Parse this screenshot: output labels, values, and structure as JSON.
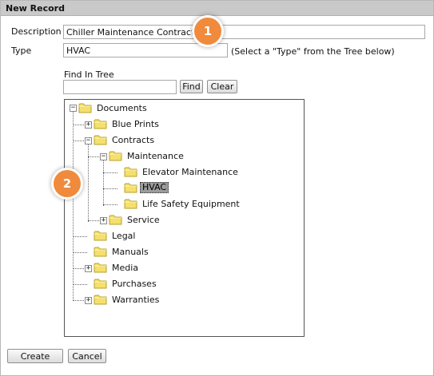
{
  "dialog": {
    "title": "New Record"
  },
  "form": {
    "description_label": "Description",
    "description_value": "Chiller Maintenance Contract",
    "type_label": "Type",
    "type_value": "HVAC",
    "type_hint": "(Select a \"Type\" from the Tree below)",
    "find_label": "Find In Tree",
    "find_value": "",
    "find_button": "Find",
    "clear_button": "Clear"
  },
  "tree": {
    "root": "Documents",
    "blue_prints": "Blue Prints",
    "contracts": "Contracts",
    "maintenance": "Maintenance",
    "elevator_maintenance": "Elevator Maintenance",
    "hvac": "HVAC",
    "life_safety_equipment": "Life Safety Equipment",
    "service": "Service",
    "legal": "Legal",
    "manuals": "Manuals",
    "media": "Media",
    "purchases": "Purchases",
    "warranties": "Warranties",
    "selected": "HVAC"
  },
  "footer": {
    "create_button": "Create",
    "cancel_button": "Cancel"
  },
  "callouts": {
    "first": "1",
    "second": "2"
  },
  "colors": {
    "callout": "#f08a3c",
    "folder": "#f4e06a",
    "selected_bg": "#9c9c9c"
  },
  "icons": {
    "folder": "folder-icon",
    "expand": "plus-box-icon",
    "collapse": "minus-box-icon"
  }
}
